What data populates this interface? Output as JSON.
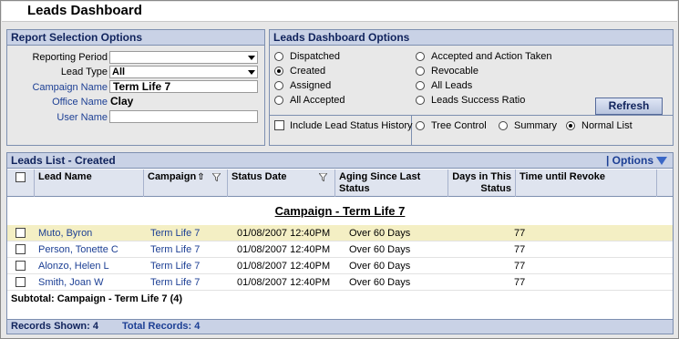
{
  "title": "Leads Dashboard",
  "report_options": {
    "header": "Report Selection Options",
    "reporting_period": {
      "label": "Reporting Period",
      "value": ""
    },
    "lead_type": {
      "label": "Lead Type",
      "value": "All"
    },
    "campaign_name": {
      "label": "Campaign Name",
      "value": "Term Life 7"
    },
    "office_name": {
      "label": "Office Name",
      "value": "Clay"
    },
    "user_name": {
      "label": "User Name",
      "value": ""
    }
  },
  "dashboard_options": {
    "header": "Leads Dashboard Options",
    "status_radios": [
      {
        "label": "Dispatched",
        "selected": false
      },
      {
        "label": "Created",
        "selected": true
      },
      {
        "label": "Assigned",
        "selected": false
      },
      {
        "label": "All Accepted",
        "selected": false
      },
      {
        "label": "Accepted and Action Taken",
        "selected": false
      },
      {
        "label": "Revocable",
        "selected": false
      },
      {
        "label": "All Leads",
        "selected": false
      },
      {
        "label": "Leads Success Ratio",
        "selected": false
      }
    ],
    "refresh_label": "Refresh",
    "include_history_label": "Include Lead Status History",
    "include_history_checked": false,
    "view_radios": [
      {
        "label": "Tree Control",
        "selected": false
      },
      {
        "label": "Summary",
        "selected": false
      },
      {
        "label": "Normal List",
        "selected": true
      }
    ]
  },
  "leads_list": {
    "header": "Leads List - Created",
    "options_label": "| Options",
    "columns": [
      "Lead Name",
      "Campaign",
      "Status Date",
      "Aging Since Last Status",
      "Days in This Status",
      "Time until Revoke"
    ],
    "sort_indicator": "⇧",
    "group_title": "Campaign - Term Life 7",
    "rows": [
      {
        "name": "Muto, Byron",
        "campaign": "Term Life 7",
        "status_date": "01/08/2007 12:40PM",
        "aging": "Over 60 Days",
        "days": "",
        "revoke": "77",
        "highlighted": true
      },
      {
        "name": "Person, Tonette C",
        "campaign": "Term Life 7",
        "status_date": "01/08/2007 12:40PM",
        "aging": "Over 60 Days",
        "days": "",
        "revoke": "77",
        "highlighted": false
      },
      {
        "name": "Alonzo, Helen L",
        "campaign": "Term Life 7",
        "status_date": "01/08/2007 12:40PM",
        "aging": "Over 60 Days",
        "days": "",
        "revoke": "77",
        "highlighted": false
      },
      {
        "name": "Smith, Joan W",
        "campaign": "Term Life 7",
        "status_date": "01/08/2007 12:40PM",
        "aging": "Over 60 Days",
        "days": "",
        "revoke": "77",
        "highlighted": false
      }
    ],
    "subtotal": "Subtotal: Campaign - Term Life 7 (4)",
    "records_shown": "Records Shown: 4",
    "total_records": "Total Records: 4"
  },
  "colors": {
    "accent": "#1c3f94",
    "header_bg": "#c9d2e6",
    "highlight_row": "#f4efc4"
  }
}
